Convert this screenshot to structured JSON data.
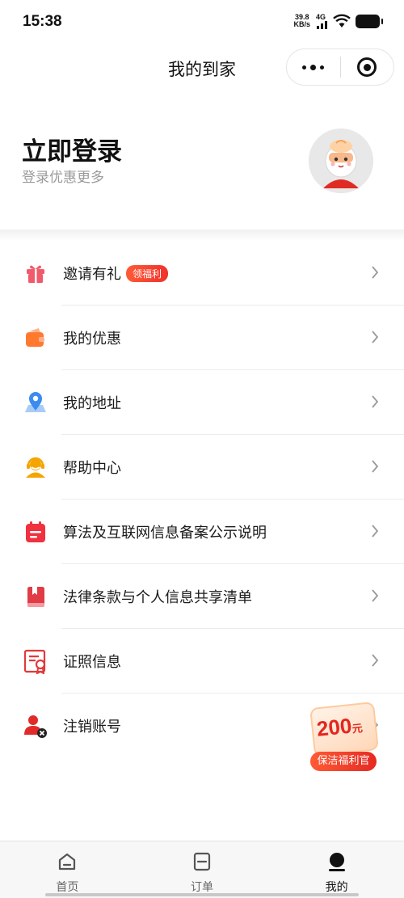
{
  "status_bar": {
    "time": "15:38",
    "net_speed_value": "39.8",
    "net_speed_unit": "KB/s",
    "network": "4G"
  },
  "header": {
    "title": "我的到家",
    "more_icon": "more-dots-icon",
    "close_icon": "target-icon"
  },
  "profile": {
    "login_title": "立即登录",
    "login_subtitle": "登录优惠更多"
  },
  "menu": {
    "items": [
      {
        "label": "邀请有礼",
        "badge": "领福利",
        "icon": "gift-icon"
      },
      {
        "label": "我的优惠",
        "icon": "wallet-icon"
      },
      {
        "label": "我的地址",
        "icon": "location-icon"
      },
      {
        "label": "帮助中心",
        "icon": "support-agent-icon"
      },
      {
        "label": "算法及互联网信息备案公示说明",
        "icon": "calendar-icon"
      },
      {
        "label": "法律条款与个人信息共享清单",
        "icon": "book-icon"
      },
      {
        "label": "证照信息",
        "icon": "certificate-icon"
      },
      {
        "label": "注销账号",
        "icon": "user-remove-icon"
      }
    ]
  },
  "coupon": {
    "amount": "200",
    "unit": "元",
    "tag": "保洁福利官"
  },
  "tabbar": {
    "tabs": [
      {
        "label": "首页",
        "icon": "home-icon",
        "active": false
      },
      {
        "label": "订单",
        "icon": "order-icon",
        "active": false
      },
      {
        "label": "我的",
        "icon": "profile-icon",
        "active": true
      }
    ]
  },
  "colors": {
    "accent_red": "#f0312b",
    "icon_orange": "#ff7a2f",
    "icon_blue": "#3c8cf0",
    "icon_yellow": "#f5a400"
  }
}
